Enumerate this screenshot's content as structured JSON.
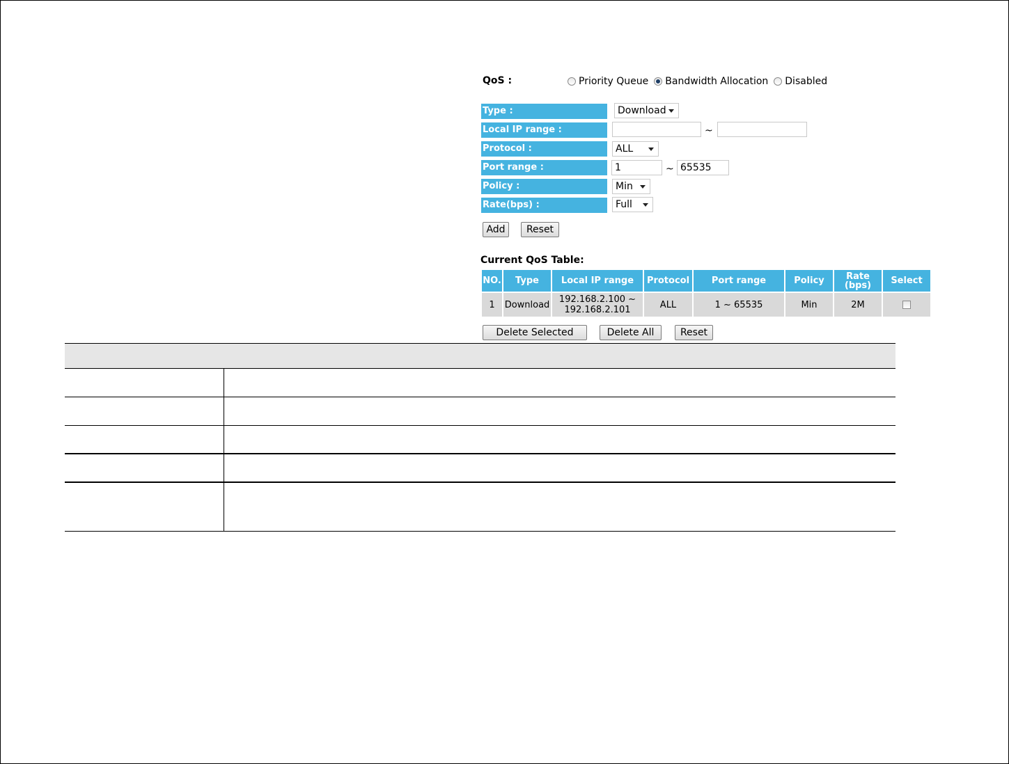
{
  "qos": {
    "label": "QoS :",
    "options": [
      {
        "label": "Priority Queue",
        "checked": false
      },
      {
        "label": "Bandwidth Allocation",
        "checked": true
      },
      {
        "label": "Disabled",
        "checked": false
      }
    ]
  },
  "form": {
    "type_label": "Type :",
    "type_value": "Download",
    "local_ip_label": "Local IP range :",
    "local_ip_start": "",
    "local_ip_end": "",
    "protocol_label": "Protocol :",
    "protocol_value": "ALL",
    "port_label": "Port range :",
    "port_start": "1",
    "port_end": "65535",
    "policy_label": "Policy :",
    "policy_value": "Min",
    "rate_label": "Rate(bps) :",
    "rate_value": "Full",
    "tilde": "~",
    "add_label": "Add",
    "reset_label": "Reset"
  },
  "table": {
    "title": "Current QoS Table:",
    "headers": [
      "NO.",
      "Type",
      "Local IP range",
      "Protocol",
      "Port range",
      "Policy",
      "Rate\n(bps)",
      "Select"
    ],
    "rate_header_line1": "Rate",
    "rate_header_line2": "(bps)",
    "rows": [
      {
        "no": "1",
        "type": "Download",
        "ip_line1": "192.168.2.100 ~",
        "ip_line2": "192.168.2.101",
        "protocol": "ALL",
        "port_range": "1 ~ 65535",
        "policy": "Min",
        "rate": "2M",
        "selected": false
      }
    ],
    "delete_selected_label": "Delete Selected",
    "delete_all_label": "Delete All",
    "reset_label": "Reset"
  }
}
